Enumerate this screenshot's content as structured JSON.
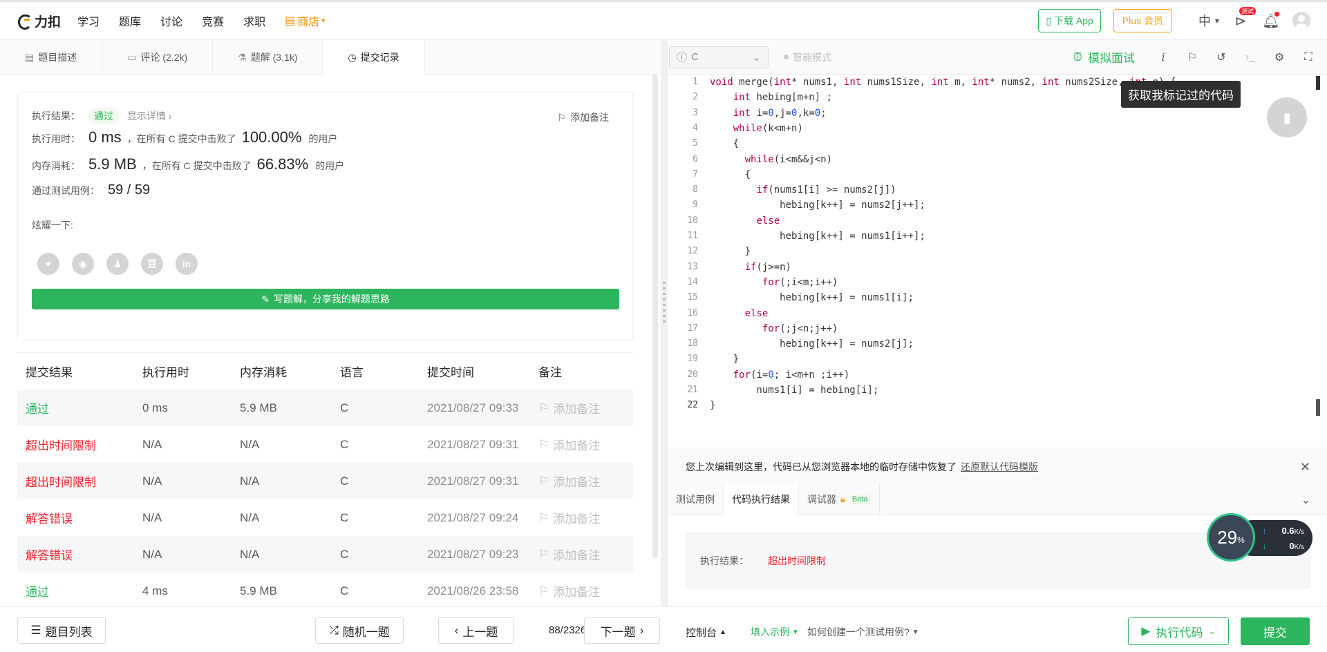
{
  "nav": {
    "logo_text": "力扣",
    "items": [
      "学习",
      "题库",
      "讨论",
      "竞赛",
      "求职"
    ],
    "shop": "商店",
    "download_app": "下载 App",
    "plus": "Plus 会员",
    "lang": "中",
    "test_badge": "测试"
  },
  "left_tabs": [
    {
      "label": "题目描述",
      "icon": "document-icon"
    },
    {
      "label": "评论 (2.2k)",
      "icon": "comment-icon"
    },
    {
      "label": "题解 (3.1k)",
      "icon": "flask-icon"
    },
    {
      "label": "提交记录",
      "icon": "clock-icon"
    }
  ],
  "result": {
    "status_label": "执行结果：",
    "status_value": "通过",
    "detail_link": "显示详情 ›",
    "add_note": "添加备注",
    "time_label": "执行用时：",
    "time_value": "0 ms",
    "time_desc": "，在所有 C 提交中击败了",
    "time_pct": "100.00%",
    "time_suffix": "的用户",
    "mem_label": "内存消耗：",
    "mem_value": "5.9 MB",
    "mem_desc": "，在所有 C 提交中击败了",
    "mem_pct": "66.83%",
    "mem_suffix": "的用户",
    "cases_label": "通过测试用例：",
    "cases_value": "59 / 59",
    "share_label": "炫耀一下:",
    "share_icons": [
      "wechat-icon",
      "weibo-icon",
      "qq-icon",
      "douban-icon",
      "linkedin-icon"
    ],
    "share_glyphs": [
      "✦",
      "◉",
      "♟",
      "豆",
      "in"
    ],
    "write_button": "写题解，分享我的解题思路"
  },
  "submissions": {
    "headers": [
      "提交结果",
      "执行用时",
      "内存消耗",
      "语言",
      "提交时间",
      "备注"
    ],
    "add_note": "添加备注",
    "rows": [
      {
        "result": "通过",
        "ok": true,
        "time": "0 ms",
        "mem": "5.9 MB",
        "lang": "C",
        "date": "2021/08/27 09:33"
      },
      {
        "result": "超出时间限制",
        "ok": false,
        "time": "N/A",
        "mem": "N/A",
        "lang": "C",
        "date": "2021/08/27 09:31"
      },
      {
        "result": "超出时间限制",
        "ok": false,
        "time": "N/A",
        "mem": "N/A",
        "lang": "C",
        "date": "2021/08/27 09:31"
      },
      {
        "result": "解答错误",
        "ok": false,
        "time": "N/A",
        "mem": "N/A",
        "lang": "C",
        "date": "2021/08/27 09:24"
      },
      {
        "result": "解答错误",
        "ok": false,
        "time": "N/A",
        "mem": "N/A",
        "lang": "C",
        "date": "2021/08/27 09:23"
      },
      {
        "result": "通过",
        "ok": true,
        "time": "4 ms",
        "mem": "5.9 MB",
        "lang": "C",
        "date": "2021/08/26 23:58"
      }
    ]
  },
  "editor": {
    "language": "C",
    "smart_mode": "智能模式",
    "mock_interview": "模拟面试",
    "tooltip": "获取我标记过的代码",
    "lines": [
      "void merge(int* nums1, int nums1Size, int m, int* nums2, int nums2Size, int n) {",
      "    int hebing[m+n] ;",
      "    int i=0,j=0,k=0;",
      "    while(k<m+n)",
      "    {",
      "      while(i<m&&j<n)",
      "      {",
      "        if(nums1[i] >= nums2[j])",
      "            hebing[k++] = nums2[j++];",
      "        else",
      "            hebing[k++] = nums1[i++];",
      "      }",
      "      if(j>=n)",
      "         for(;i<m;i++)",
      "            hebing[k++] = nums1[i];",
      "      else",
      "         for(;j<n;j++)",
      "            hebing[k++] = nums2[j];",
      "    }",
      "    for(i=0; i<m+n ;i++)",
      "        nums1[i] = hebing[i];",
      "}"
    ],
    "current_line": 22
  },
  "restore": {
    "message": "您上次编辑到这里，代码已从您浏览器本地的临时存储中恢复了",
    "link": "还原默认代码模版"
  },
  "console": {
    "tabs": [
      "测试用例",
      "代码执行结果",
      "调试器"
    ],
    "beta": "Beta",
    "exec_label": "执行结果：",
    "exec_value": "超出时间限制"
  },
  "network": {
    "cpu": "29",
    "cpu_unit": "%",
    "up": "0.6",
    "down": "0",
    "unit": "K/s"
  },
  "bottom": {
    "problem_list": "题目列表",
    "random": "随机一题",
    "prev": "上一题",
    "page": "88/2326",
    "next": "下一题",
    "console": "控制台",
    "fill_example": "填入示例",
    "how_create": "如何创建一个测试用例?",
    "run": "执行代码",
    "submit": "提交"
  },
  "colors": {
    "accent_green": "#2db55d",
    "error_red": "#f5222d",
    "plus_orange": "#ffa116"
  }
}
